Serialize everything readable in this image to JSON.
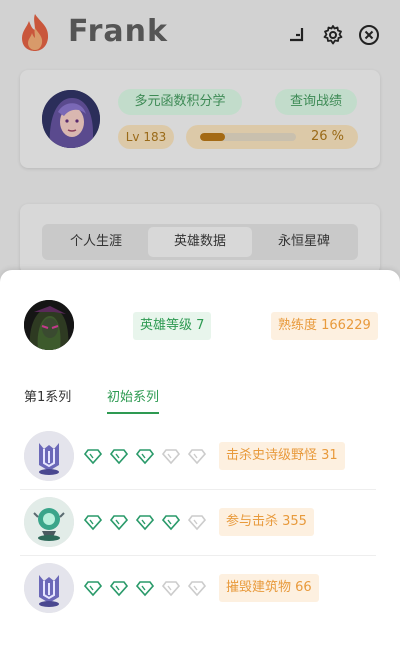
{
  "app": {
    "title": "Frank"
  },
  "titlebar": {
    "icons": [
      "pin-icon",
      "gear-icon",
      "close-icon"
    ]
  },
  "profile": {
    "nickname": "多元函数积分学",
    "history_button": "查询战绩",
    "level": "Lv 183",
    "xp_percent": 26,
    "xp_text": "26 %"
  },
  "tabs": [
    "个人生涯",
    "英雄数据",
    "永恒星碑"
  ],
  "active_tab": 1,
  "hero": {
    "level_tag": "英雄等级 7",
    "mastery_tag": "熟练度 166229"
  },
  "series_tabs": [
    "第1系列",
    "初始系列"
  ],
  "active_series": 1,
  "statstones": [
    {
      "label": "击杀史诗级野怪 31",
      "filled_gems": 3,
      "total_gems": 5
    },
    {
      "label": "参与击杀 355",
      "filled_gems": 4,
      "total_gems": 5
    },
    {
      "label": "摧毁建筑物 66",
      "filled_gems": 3,
      "total_gems": 5
    }
  ],
  "colors": {
    "green": "#2e9a52",
    "orange": "#e89a3c",
    "gem_filled": "#2a9a6a",
    "gem_empty": "#cccccc"
  }
}
